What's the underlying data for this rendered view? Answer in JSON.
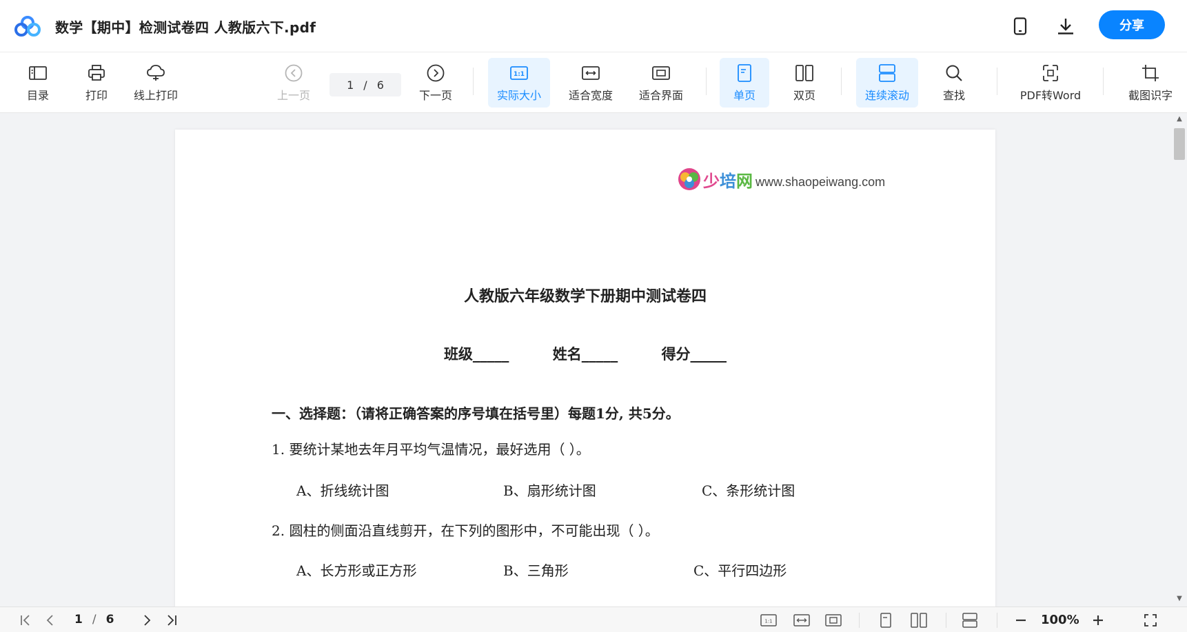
{
  "titlebar": {
    "title": "数学【期中】检测试卷四 人教版六下.pdf",
    "share_label": "分享",
    "accent": "#0984ff"
  },
  "toolbar": {
    "catalog": "目录",
    "print": "打印",
    "online_print": "线上打印",
    "prev_page": "上一页",
    "page_current": "1",
    "page_sep": "/",
    "page_total": "6",
    "next_page": "下一页",
    "actual_size": "实际大小",
    "fit_width": "适合宽度",
    "fit_page": "适合界面",
    "single_page": "单页",
    "double_page": "双页",
    "continuous": "连续滚动",
    "find": "查找",
    "pdf_to_word": "PDF转Word",
    "ocr": "截图识字",
    "active_color": "#1a8cff"
  },
  "document": {
    "brand_cn_1": "少",
    "brand_cn_2": "培",
    "brand_cn_3": "网",
    "brand_url": "www.shaopeiwang.com",
    "title": "人教版六年级数学下册期中测试卷四",
    "info_class": "班级_____",
    "info_name": "姓名_____",
    "info_score": "得分_____",
    "section1": "一、选择题：（请将正确答案的序号填在括号里）每题1分, 共5分。",
    "q1": "1.  要统计某地去年月平均气温情况，最好选用（          ）。",
    "q1_a": "A、折线统计图",
    "q1_b": "B、扇形统计图",
    "q1_c": "C、条形统计图",
    "q2": "2.  圆柱的侧面沿直线剪开，在下列的图形中，不可能出现（          ）。",
    "q2_a": "A、长方形或正方形",
    "q2_b": "B、三角形",
    "q2_c": "C、平行四边形"
  },
  "statusbar": {
    "page_current": "1",
    "page_sep": "/",
    "page_total": "6",
    "zoom": "100%"
  }
}
